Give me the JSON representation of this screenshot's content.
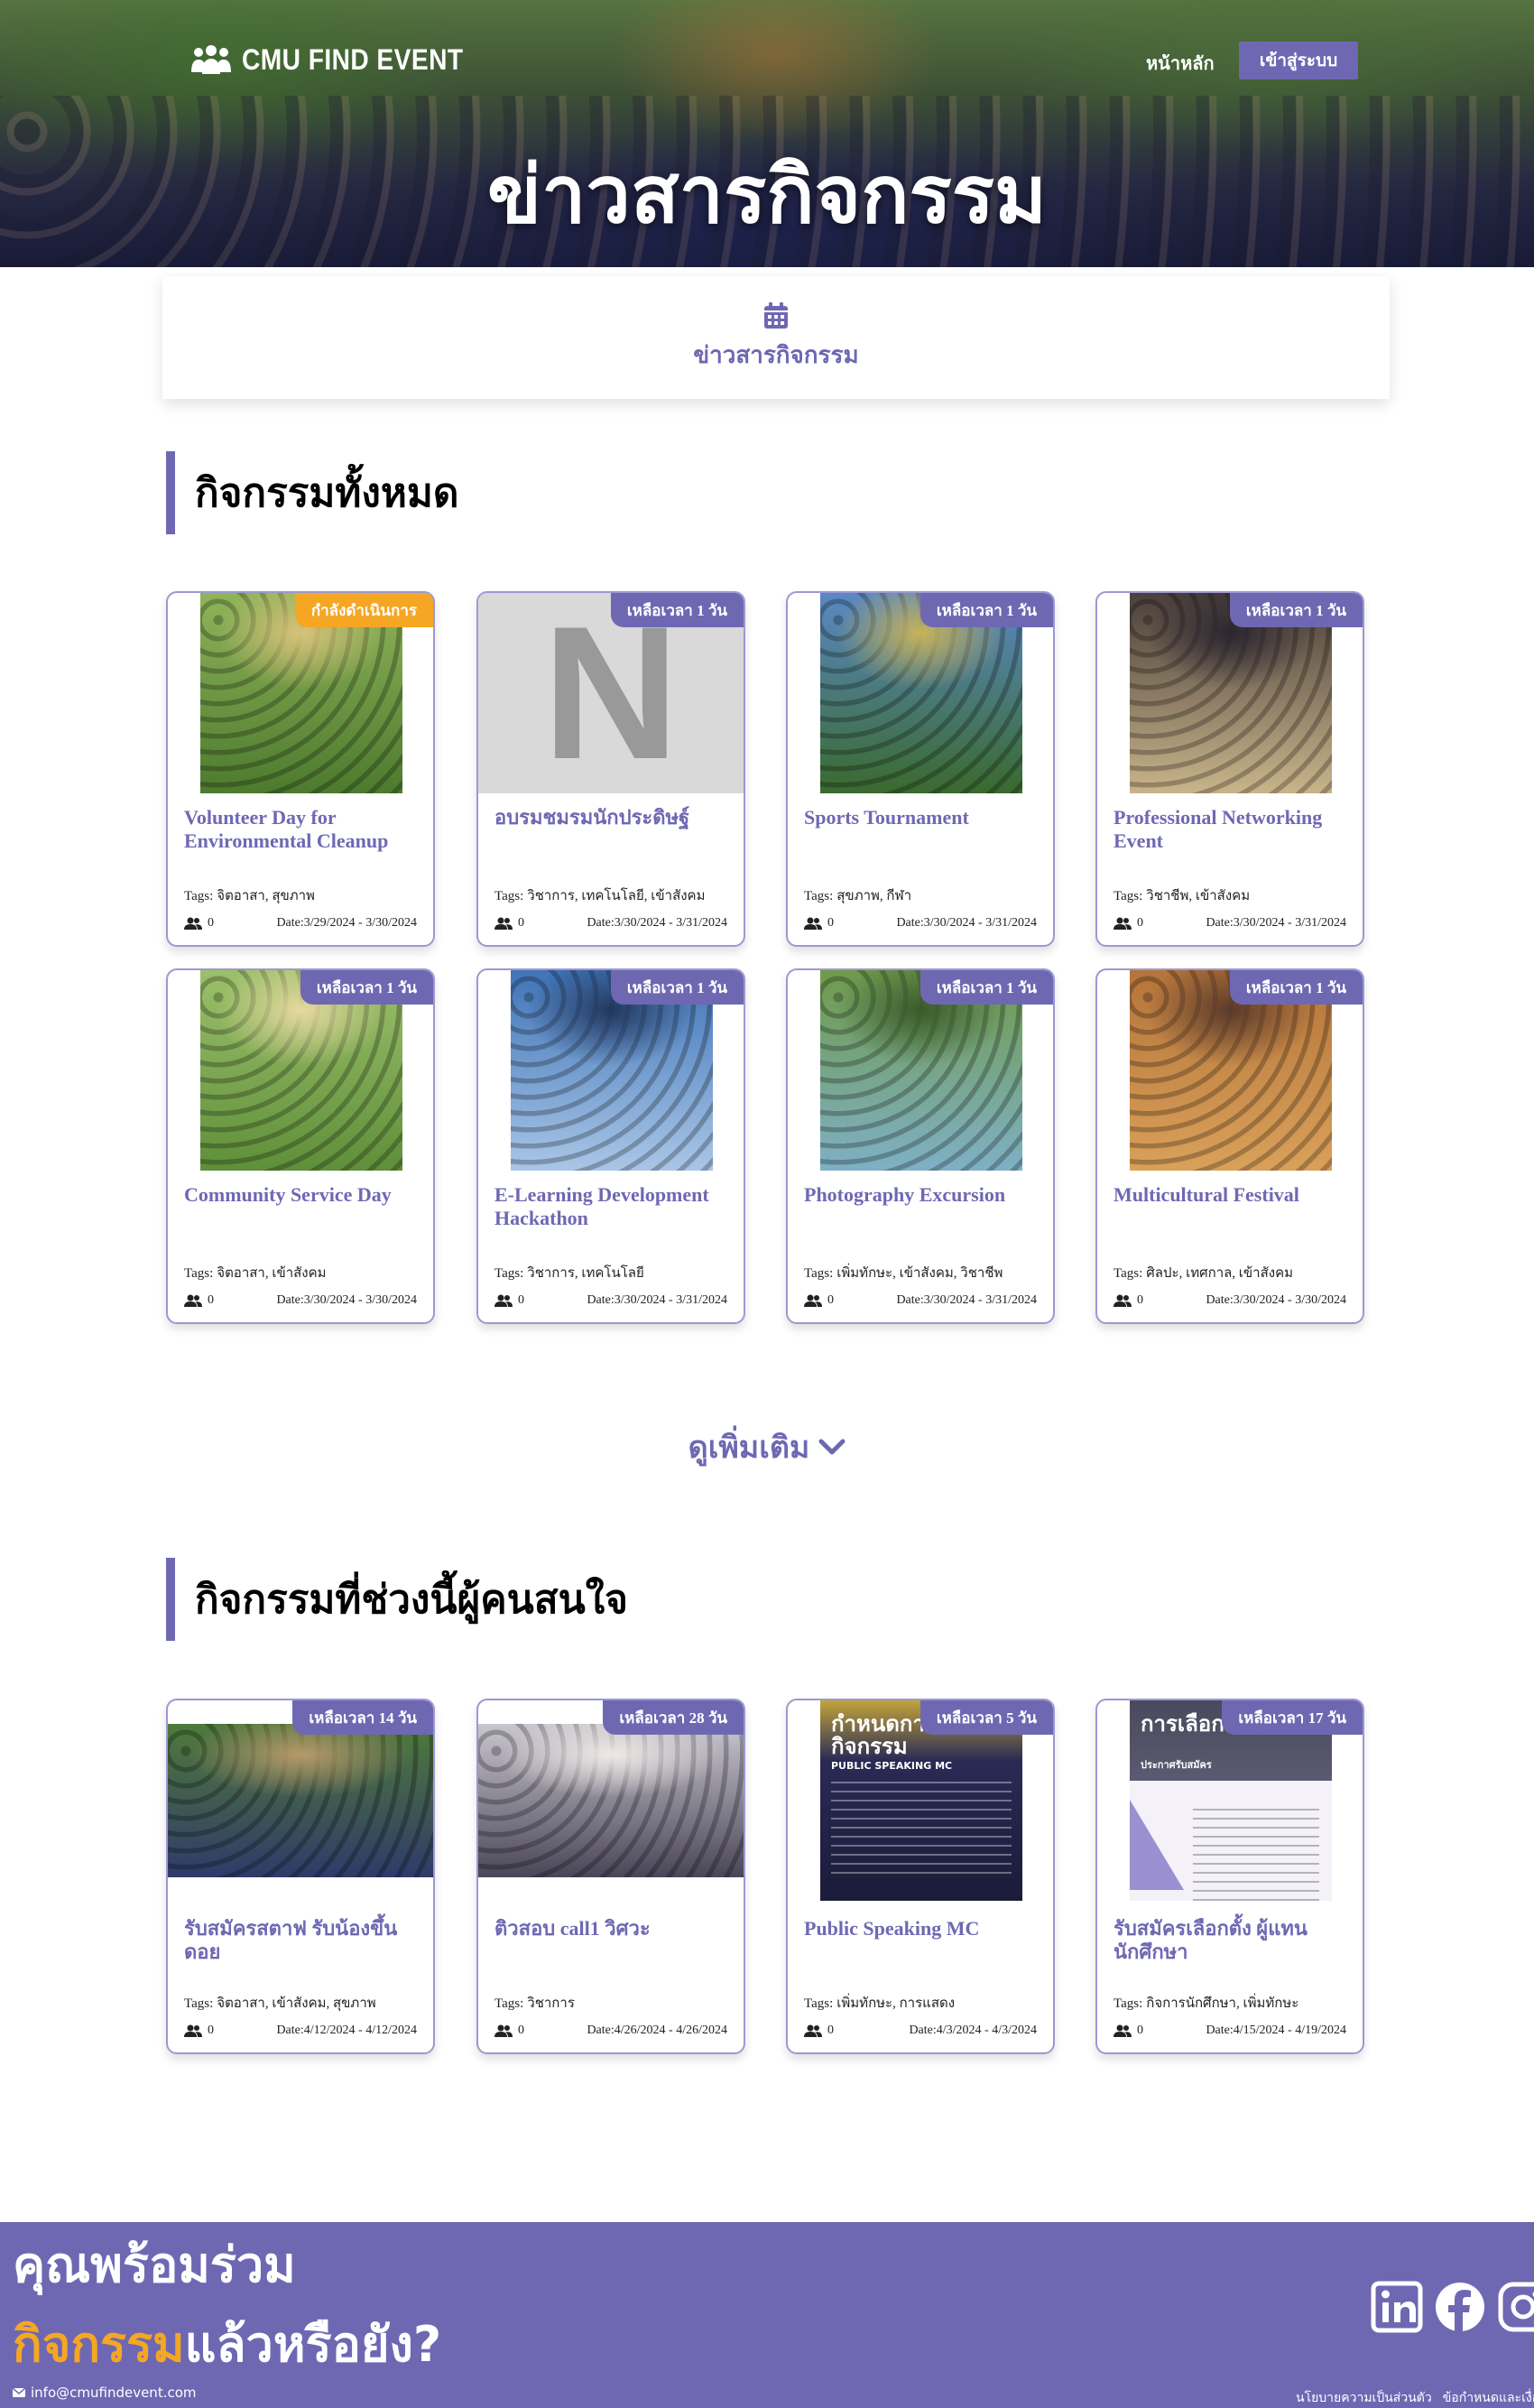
{
  "header": {
    "brand": "CMU FIND EVENT",
    "nav_home": "หน้าหลัก",
    "nav_login": "เข้าสู่ระบบ",
    "hero_title": "ข่าวสารกิจกรรม"
  },
  "tab": {
    "label": "ข่าวสารกิจกรรม",
    "icon": "calendar-icon"
  },
  "sections": {
    "all_title": "กิจกรรมทั้งหมด",
    "popular_title": "กิจกรรมที่ช่วงนี้ผู้คนสนใจ",
    "see_more": "ดูเพิ่มเติม"
  },
  "tags_prefix": "Tags:",
  "date_prefix": "Date:",
  "all_events": [
    {
      "title": "Volunteer Day for Environmental Cleanup",
      "badge": "กำลังดำเนินการ",
      "badge_color": "#f5a623",
      "tags": "จิตอาสา, สุขภาพ",
      "count": "0",
      "date": "3/29/2024 - 3/30/2024"
    },
    {
      "title": "อบรมชมรมนักประดิษฐ์",
      "badge": "เหลือเวลา 1 วัน",
      "badge_color": "#6e68b3",
      "tags": "วิชาการ, เทคโนโลยี, เข้าสังคม",
      "count": "0",
      "date": "3/30/2024 - 3/31/2024",
      "placeholder_letter": "N"
    },
    {
      "title": "Sports Tournament",
      "badge": "เหลือเวลา 1 วัน",
      "badge_color": "#6e68b3",
      "tags": "สุขภาพ, กีฬา",
      "count": "0",
      "date": "3/30/2024 - 3/31/2024"
    },
    {
      "title": "Professional Networking Event",
      "badge": "เหลือเวลา 1 วัน",
      "badge_color": "#6e68b3",
      "tags": "วิชาชีพ, เข้าสังคม",
      "count": "0",
      "date": "3/30/2024 - 3/31/2024"
    },
    {
      "title": "Community Service Day",
      "badge": "เหลือเวลา 1 วัน",
      "badge_color": "#6e68b3",
      "tags": "จิตอาสา, เข้าสังคม",
      "count": "0",
      "date": "3/30/2024 - 3/30/2024"
    },
    {
      "title": "E-Learning Development Hackathon",
      "badge": "เหลือเวลา 1 วัน",
      "badge_color": "#6e68b3",
      "tags": "วิชาการ, เทคโนโลยี",
      "count": "0",
      "date": "3/30/2024 - 3/31/2024"
    },
    {
      "title": "Photography Excursion",
      "badge": "เหลือเวลา 1 วัน",
      "badge_color": "#6e68b3",
      "tags": "เพิ่มทักษะ, เข้าสังคม, วิชาชีพ",
      "count": "0",
      "date": "3/30/2024 - 3/31/2024"
    },
    {
      "title": "Multicultural Festival",
      "badge": "เหลือเวลา 1 วัน",
      "badge_color": "#6e68b3",
      "tags": "ศิลปะ, เทศกาล, เข้าสังคม",
      "count": "0",
      "date": "3/30/2024 - 3/30/2024"
    }
  ],
  "popular_events": [
    {
      "title": "รับสมัครสตาฟ รับน้องขึ้นดอย",
      "badge": "เหลือเวลา 14 วัน",
      "badge_color": "#6e68b3",
      "tags": "จิตอาสา, เข้าสังคม, สุขภาพ",
      "count": "0",
      "date": "4/12/2024 - 4/12/2024"
    },
    {
      "title": "ติวสอบ call1 วิศวะ",
      "badge": "เหลือเวลา 28 วัน",
      "badge_color": "#6e68b3",
      "tags": "วิชาการ",
      "count": "0",
      "date": "4/26/2024 - 4/26/2024"
    },
    {
      "title": "Public Speaking MC",
      "badge": "เหลือเวลา 5 วัน",
      "badge_color": "#6e68b3",
      "tags": "เพิ่มทักษะ, การแสดง",
      "count": "0",
      "date": "4/3/2024 - 4/3/2024",
      "poster_title": "กำหนดการกิจกรรม",
      "poster_subtitle": "PUBLIC SPEAKING MC"
    },
    {
      "title": "รับสมัครเลือกตั้ง ผู้แทนนักศึกษา",
      "badge": "เหลือเวลา 17 วัน",
      "badge_color": "#6e68b3",
      "tags": "กิจการนักศึกษา, เพิ่มทักษะ",
      "count": "0",
      "date": "4/15/2024 - 4/19/2024",
      "poster_title": "การเลือกตั้ง 67",
      "poster_subtitle": "ประกาศรับสมัคร"
    }
  ],
  "footer": {
    "cta_line1": "คุณพร้อมร่วม",
    "cta_highlight": "กิจกรรม",
    "cta_rest": "แล้วหรือยัง?",
    "email": "info@cmufindevent.com",
    "privacy": "นโยบายความเป็นส่วนตัว",
    "terms": "ข้อกำหนดและเงื่อนไข",
    "socials": [
      "linkedin-icon",
      "facebook-icon",
      "instagram-icon"
    ]
  },
  "colors": {
    "accent": "#6e68b3",
    "ongoing": "#f5a623",
    "border": "#9d98d2"
  }
}
